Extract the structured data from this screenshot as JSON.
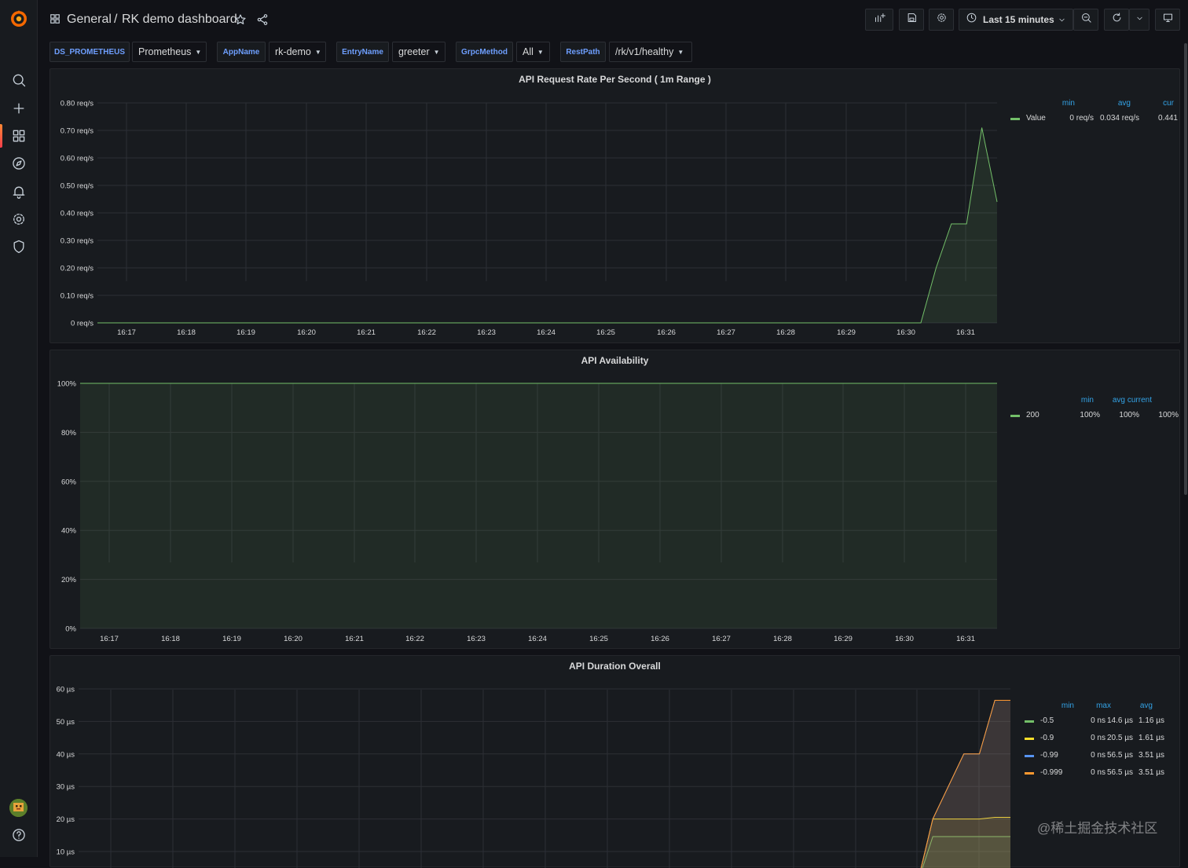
{
  "breadcrumb": {
    "folder": "General",
    "separator": "/",
    "dashboard": "RK demo dashboard"
  },
  "time_picker": {
    "label": "Last 15 minutes"
  },
  "variables": [
    {
      "name": "DS_PROMETHEUS",
      "value": "Prometheus"
    },
    {
      "name": "AppName",
      "value": "rk-demo"
    },
    {
      "name": "EntryName",
      "value": "greeter"
    },
    {
      "name": "GrpcMethod",
      "value": "All"
    },
    {
      "name": "RestPath",
      "value": "/rk/v1/healthy"
    }
  ],
  "icons": {
    "logo": "grafana-logo-icon",
    "sidebar": [
      "search-icon",
      "plus-icon",
      "dashboards-icon",
      "explore-icon",
      "alert-bell-icon",
      "gear-icon",
      "shield-icon",
      "help-icon"
    ],
    "toolbar": [
      "add-panel-icon",
      "save-icon",
      "settings-icon",
      "clock-icon",
      "zoom-out-icon",
      "refresh-icon",
      "tv-mode-icon"
    ]
  },
  "colors": {
    "accent": "#6e9fff",
    "series_green": "#73bf69",
    "series_yellow": "#fade2a",
    "series_cyan": "#5794f2",
    "series_orange": "#ff9830",
    "legend_header": "#33a2e5"
  },
  "watermark": "@稀土掘金技术社区",
  "chart_data": [
    {
      "type": "area",
      "title": "API Request Rate Per Second ( 1m Range )",
      "x_ticks": [
        "16:17",
        "16:18",
        "16:19",
        "16:20",
        "16:21",
        "16:22",
        "16:23",
        "16:24",
        "16:25",
        "16:26",
        "16:27",
        "16:28",
        "16:29",
        "16:30",
        "16:31"
      ],
      "y_ticks": [
        "0 req/s",
        "0.10 req/s",
        "0.20 req/s",
        "0.30 req/s",
        "0.40 req/s",
        "0.50 req/s",
        "0.60 req/s",
        "0.70 req/s",
        "0.80 req/s"
      ],
      "ylim": [
        0,
        0.8
      ],
      "xlim": [
        16.75,
        31.5
      ],
      "series": [
        {
          "name": "Value",
          "color": "#73bf69",
          "x": [
            16.75,
            30.25,
            30.5,
            30.75,
            31.0,
            31.25,
            31.5
          ],
          "y": [
            0,
            0,
            0.2,
            0.36,
            0.36,
            0.71,
            0.44
          ]
        }
      ],
      "legend": {
        "headers": [
          "min",
          "avg",
          "cur"
        ],
        "rows": [
          {
            "name": "Value",
            "color": "#73bf69",
            "values": [
              "0 req/s",
              "0.034 req/s",
              "0.441"
            ]
          }
        ]
      }
    },
    {
      "type": "area",
      "title": "API Availability",
      "x_ticks": [
        "16:17",
        "16:18",
        "16:19",
        "16:20",
        "16:21",
        "16:22",
        "16:23",
        "16:24",
        "16:25",
        "16:26",
        "16:27",
        "16:28",
        "16:29",
        "16:30",
        "16:31"
      ],
      "y_ticks": [
        "0%",
        "20%",
        "40%",
        "60%",
        "80%",
        "100%"
      ],
      "ylim": [
        0,
        100
      ],
      "xlim": [
        16.5,
        31.5
      ],
      "series": [
        {
          "name": "200",
          "color": "#73bf69",
          "x": [
            16.5,
            31.5
          ],
          "y": [
            100,
            100
          ]
        }
      ],
      "legend": {
        "headers": [
          "min",
          "avg",
          "current"
        ],
        "rows": [
          {
            "name": "200",
            "color": "#73bf69",
            "values": [
              "100%",
              "100%",
              "100%"
            ]
          }
        ]
      }
    },
    {
      "type": "area",
      "title": "API Duration Overall",
      "y_ticks": [
        "10 µs",
        "20 µs",
        "30 µs",
        "40 µs",
        "50 µs",
        "60 µs"
      ],
      "ylim": [
        0,
        60
      ],
      "xlim": [
        16.5,
        31.5
      ],
      "series": [
        {
          "name": "-0.5",
          "color": "#73bf69",
          "x": [
            16.5,
            30.0,
            30.25,
            30.75,
            31.0,
            31.25,
            31.5
          ],
          "y": [
            0,
            0,
            14.6,
            14.6,
            14.6,
            14.6,
            14.6
          ]
        },
        {
          "name": "-0.9",
          "color": "#fade2a",
          "x": [
            16.5,
            30.0,
            30.25,
            30.75,
            31.0,
            31.25,
            31.5
          ],
          "y": [
            0,
            0,
            20,
            20,
            20,
            20.5,
            20.5
          ]
        },
        {
          "name": "-0.99",
          "color": "#5794f2",
          "x": [
            16.5,
            30.0,
            30.25,
            30.75,
            31.0,
            31.25,
            31.5
          ],
          "y": [
            0,
            0,
            20,
            40,
            40,
            56.5,
            56.5
          ]
        },
        {
          "name": "-0.999",
          "color": "#ff9830",
          "x": [
            16.5,
            30.0,
            30.25,
            30.75,
            31.0,
            31.25,
            31.5
          ],
          "y": [
            0,
            0,
            20,
            40,
            40,
            56.5,
            56.5
          ]
        }
      ],
      "legend": {
        "headers": [
          "min",
          "max",
          "avg"
        ],
        "rows": [
          {
            "name": "-0.5",
            "color": "#73bf69",
            "values": [
              "0 ns",
              "14.6 µs",
              "1.16 µs"
            ]
          },
          {
            "name": "-0.9",
            "color": "#fade2a",
            "values": [
              "0 ns",
              "20.5 µs",
              "1.61 µs"
            ]
          },
          {
            "name": "-0.99",
            "color": "#5794f2",
            "values": [
              "0 ns",
              "56.5 µs",
              "3.51 µs"
            ]
          },
          {
            "name": "-0.999",
            "color": "#ff9830",
            "values": [
              "0 ns",
              "56.5 µs",
              "3.51 µs"
            ]
          }
        ]
      }
    }
  ]
}
